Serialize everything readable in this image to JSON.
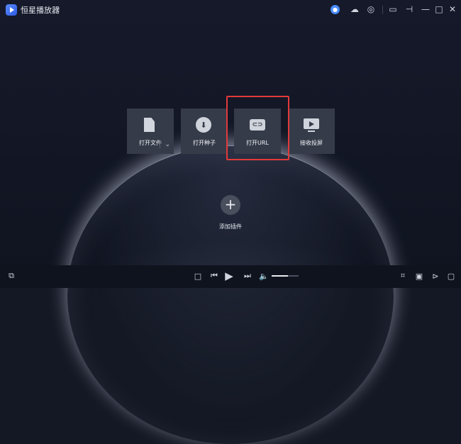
{
  "titlebar": {
    "app_title": "恒星播放器",
    "caret": "⌄"
  },
  "tiles": [
    {
      "label": "打开文件",
      "icon": "file-icon",
      "dropdown": "⌄"
    },
    {
      "label": "打开种子",
      "icon": "download-icon"
    },
    {
      "label": "打开URL",
      "icon": "url-link-icon"
    },
    {
      "label": "接收投屏",
      "icon": "screen-cast-icon"
    }
  ],
  "add_plugin": {
    "label": "添加插件",
    "symbol": "+"
  },
  "highlight_color": "#e23a3a",
  "volume_level": 0.6
}
